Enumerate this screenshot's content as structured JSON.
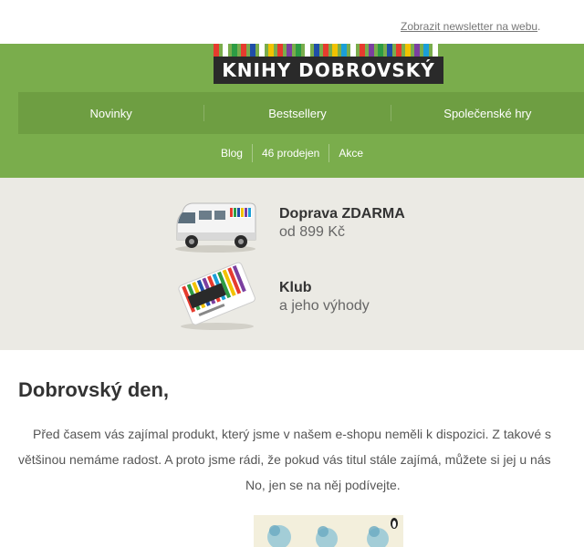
{
  "topbar": {
    "web_link": "Zobrazit newsletter na webu",
    "web_link_suffix": "."
  },
  "logo": {
    "text": "KNIHY DOBROVSKÝ",
    "stripe_colors": [
      "#e63b2e",
      "#ffffff",
      "#2d9c44",
      "#e63b2e",
      "#1f4ea8",
      "#ffffff",
      "#f2c200",
      "#e63b2e",
      "#7b3fa0",
      "#2d9c44",
      "#ffffff",
      "#1f4ea8",
      "#e63b2e",
      "#f2c200",
      "#1a9fd8",
      "#ffffff",
      "#e63b2e",
      "#7b3fa0",
      "#2d9c44",
      "#1f4ea8",
      "#e63b2e",
      "#f2c200",
      "#7b3fa0",
      "#1a9fd8",
      "#ffffff"
    ]
  },
  "subnav": [
    "Blog",
    "46 prodejen",
    "Akce"
  ],
  "menu": [
    "Novinky",
    "Bestsellery",
    "Společenské hry"
  ],
  "benefits": [
    {
      "title": "Doprava ZDARMA",
      "subtitle": "od 899 Kč",
      "icon": "delivery-van-icon"
    },
    {
      "title": "Klub",
      "subtitle": "a jeho výhody",
      "icon": "club-card-icon"
    }
  ],
  "content": {
    "greeting": "Dobrovský den,",
    "lines": [
      "Před časem vás zajímal produkt, který jsme v našem e-shopu neměli k dispozici. Z takové s",
      "většinou nemáme radost. A proto jsme rádi, že pokud vás titul stále zajímá, můžete si jej u nás",
      "No, jen se na něj podívejte."
    ]
  },
  "colors": {
    "header_green": "#7aad4c",
    "menu_green": "#6e9e42",
    "benefits_bg": "#ebeae4"
  }
}
